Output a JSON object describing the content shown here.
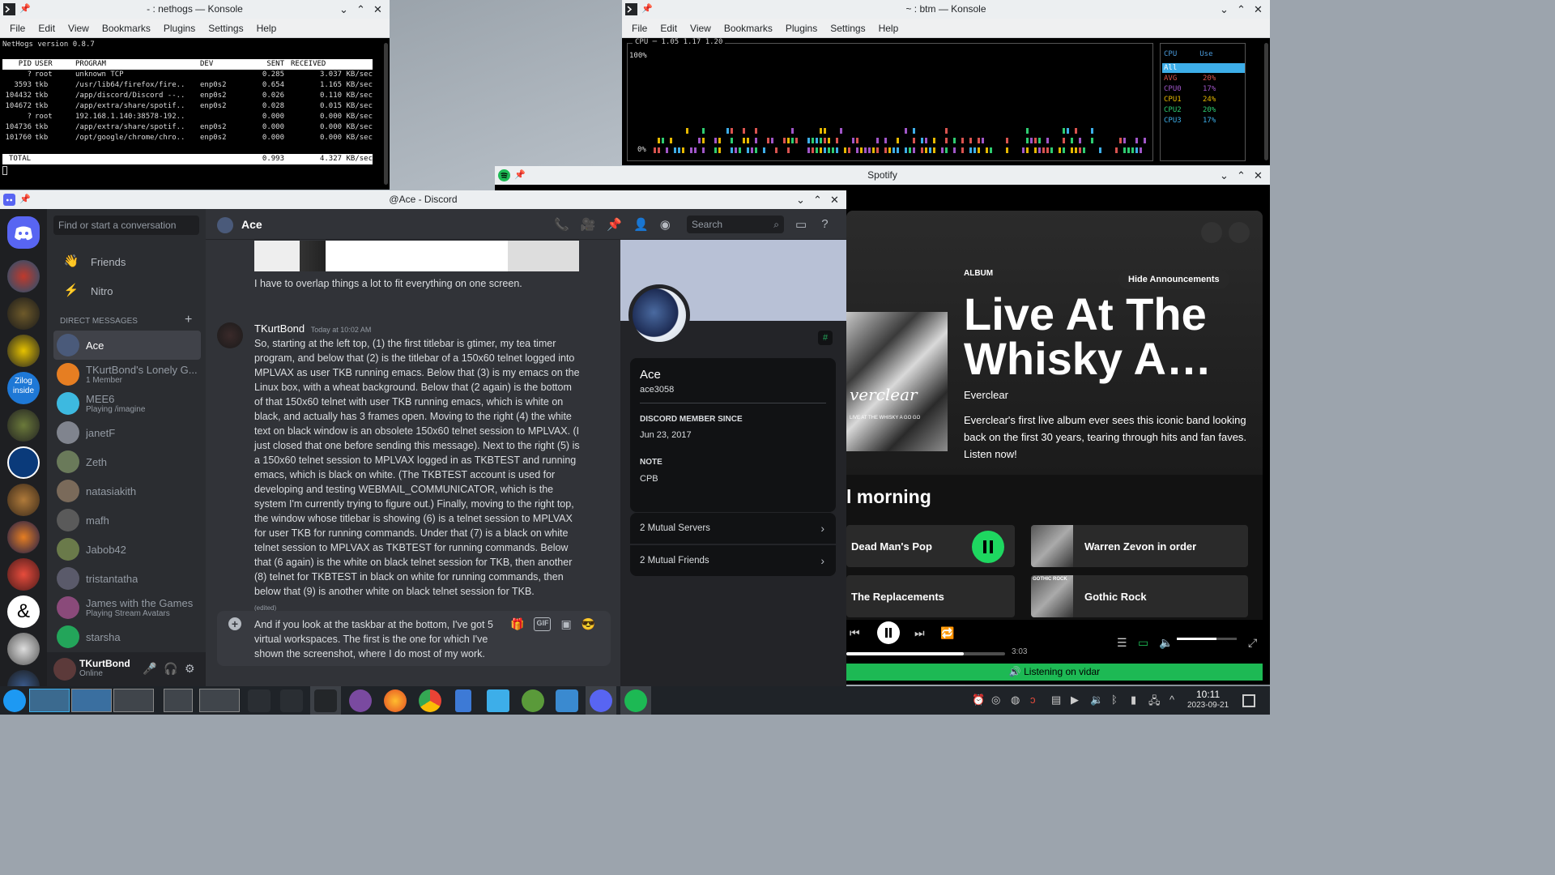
{
  "nethogs_window": {
    "title": "- : nethogs — Konsole",
    "menu": [
      "File",
      "Edit",
      "View",
      "Bookmarks",
      "Plugins",
      "Settings",
      "Help"
    ],
    "version": "NetHogs version 0.8.7",
    "columns": [
      "PID",
      "USER",
      "PROGRAM",
      "DEV",
      "SENT",
      "RECEIVED"
    ],
    "rows": [
      {
        "pid": "?",
        "user": "root",
        "program": "unknown TCP",
        "dev": "",
        "sent": "0.285",
        "received": "3.037 KB/sec"
      },
      {
        "pid": "3593",
        "user": "tkb",
        "program": "/usr/lib64/firefox/fire..",
        "dev": "enp0s2",
        "sent": "0.654",
        "received": "1.165 KB/sec"
      },
      {
        "pid": "104432",
        "user": "tkb",
        "program": "/app/discord/Discord --..",
        "dev": "enp0s2",
        "sent": "0.026",
        "received": "0.110 KB/sec"
      },
      {
        "pid": "104672",
        "user": "tkb",
        "program": "/app/extra/share/spotif..",
        "dev": "enp0s2",
        "sent": "0.028",
        "received": "0.015 KB/sec"
      },
      {
        "pid": "?",
        "user": "root",
        "program": "192.168.1.140:38578-192..",
        "dev": "",
        "sent": "0.000",
        "received": "0.000 KB/sec"
      },
      {
        "pid": "104736",
        "user": "tkb",
        "program": "/app/extra/share/spotif..",
        "dev": "enp0s2",
        "sent": "0.000",
        "received": "0.000 KB/sec"
      },
      {
        "pid": "101760",
        "user": "tkb",
        "program": "/opt/google/chrome/chro..",
        "dev": "enp0s2",
        "sent": "0.000",
        "received": "0.000 KB/sec"
      }
    ],
    "total": {
      "label": "TOTAL",
      "sent": "0.993",
      "received": "4.327 KB/sec"
    }
  },
  "btm_window": {
    "title": "~ : btm — Konsole",
    "menu": [
      "File",
      "Edit",
      "View",
      "Bookmarks",
      "Plugins",
      "Settings",
      "Help"
    ],
    "graph_title": "CPU ─ 1.05 1.17 1.20",
    "y_max": "100%",
    "y_min": "0%",
    "legend_headers": [
      "CPU",
      "Use"
    ],
    "legend": [
      {
        "name": "All",
        "use": "",
        "color": "#ffffff"
      },
      {
        "name": "AVG",
        "use": "20%",
        "color": "#d9534f"
      },
      {
        "name": "CPU0",
        "use": "17%",
        "color": "#a056c8"
      },
      {
        "name": "CPU1",
        "use": "24%",
        "color": "#e6b800"
      },
      {
        "name": "CPU2",
        "use": "20%",
        "color": "#2ecc71"
      },
      {
        "name": "CPU3",
        "use": "17%",
        "color": "#3daee9"
      }
    ]
  },
  "spotify_window": {
    "title": "Spotify",
    "kind": "ALBUM",
    "hide_button": "Hide Announcements",
    "album_title": "Live At The Whisky A…",
    "artist": "Everclear",
    "description": "Everclear's first live album ever sees this iconic band looking back on the first 30 years, tearing through hits and fan faves. Listen now!",
    "cover_text": "verclear",
    "cover_sub": "LIVE AT THE WHISKY A GO GO",
    "greeting": "l morning",
    "tiles": [
      "Dead Man's Pop",
      "Warren Zevon in order",
      "The Replacements",
      "Gothic Rock"
    ],
    "tile_art_label": "GOTHIC ROCK",
    "time": "3:03",
    "progress": 0.74,
    "volume": 0.66,
    "listening": "Listening on vidar"
  },
  "discord_window": {
    "title": "@Ace - Discord",
    "search_placeholder": "Find or start a conversation",
    "nav": [
      {
        "label": "Friends",
        "icon": "friends-icon"
      },
      {
        "label": "Nitro",
        "icon": "nitro-icon"
      }
    ],
    "dm_header": "DIRECT MESSAGES",
    "dms": [
      {
        "name": "Ace",
        "sub": "",
        "color": "#4a5a7a"
      },
      {
        "name": "TKurtBond's Lonely G...",
        "sub": "1 Member",
        "color": "#e67e22"
      },
      {
        "name": "MEE6",
        "sub": "Playing /imagine",
        "color": "#3db9e0"
      },
      {
        "name": "janetF",
        "sub": "",
        "color": "#80848e"
      },
      {
        "name": "Zeth",
        "sub": "",
        "color": "#6a7a5a"
      },
      {
        "name": "natasiakith",
        "sub": "",
        "color": "#7a6a5a"
      },
      {
        "name": "mafh",
        "sub": "",
        "color": "#5a5a5a"
      },
      {
        "name": "Jabob42",
        "sub": "",
        "color": "#6a7a4a"
      },
      {
        "name": "tristantatha",
        "sub": "",
        "color": "#5a5a6a"
      },
      {
        "name": "James with the Games",
        "sub": "Playing Stream Avatars",
        "color": "#8a4a7a"
      },
      {
        "name": "starsha",
        "sub": "",
        "color": "#23a55a"
      }
    ],
    "user": {
      "name": "TKurtBond",
      "status": "Online"
    },
    "channel": "Ace",
    "header_search": "Search",
    "prev_message": "I have to overlap things a lot to fit everything on one screen.",
    "author": "TKurtBond",
    "timestamp": "Today at 10:02 AM",
    "message": "So, starting at the left top, (1) the first titlebar is  gtimer, my tea timer program, and below that (2) is the titlebar of a  150x60 telnet logged into MPLVAX as user TKB running emacs.  Below that (3) is my emacs on the Linux box, with a wheat background.  Below that (2 again) is the bottom of that 150x60 telnet  with user TKB running emacs, which is white on black, and actually has 3 frames open. Moving to the right (4) the white text on black window is an obsolete 150x60 telnet session to MPLVAX.  (I just closed that one before sending this message).  Next to the right (5) is a 150x60 telnet session to MPLVAX logged in as TKBTEST and running emacs, which is black on white.  (The TKBTEST account is used for developing and testing WEBMAIL_COMMUNICATOR, which is the system I'm currently trying to figure out.)  Finally, moving to the right top, the window whose titlebar is showing (6) is a telnet session to MPLVAX for user TKB for running commands.  Under that (7) is a black on white telnet session to MPLVAX as TKBTEST for running commands.  Below that  (6 again) is the white on black telnet session for TKB, then another (8) telnet for TKBTEST in black on white for running commands, then below that  (9) is another white on black telnet session for TKB.",
    "edited": "(edited)",
    "draft": "And if you look at the taskbar at the bottom, I've got 5 virtual workspaces.  The first is the one for which I've shown the screenshot, where I do most of my work.",
    "gif_label": "GIF",
    "profile": {
      "name": "Ace",
      "username": "ace3058",
      "member_since_label": "DISCORD MEMBER SINCE",
      "member_since": "Jun 23, 2017",
      "note_label": "NOTE",
      "note": "CPB",
      "mutual_servers": "2 Mutual Servers",
      "mutual_friends": "2 Mutual Friends"
    }
  },
  "taskbar": {
    "time": "10:11",
    "date": "2023-09-21"
  }
}
